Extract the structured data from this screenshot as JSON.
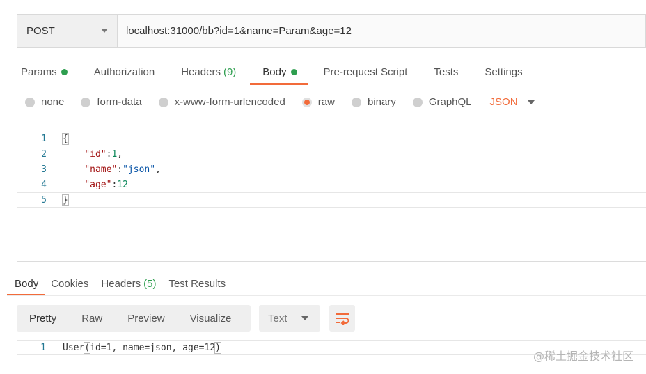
{
  "request": {
    "method": "POST",
    "url": "localhost:31000/bb?id=1&name=Param&age=12"
  },
  "request_tabs": [
    {
      "label": "Params",
      "dot": true
    },
    {
      "label": "Authorization"
    },
    {
      "label": "Headers",
      "count": "(9)"
    },
    {
      "label": "Body",
      "dot": true,
      "active": true
    },
    {
      "label": "Pre-request Script"
    },
    {
      "label": "Tests"
    },
    {
      "label": "Settings"
    }
  ],
  "body_types": {
    "options": [
      "none",
      "form-data",
      "x-www-form-urlencoded",
      "raw",
      "binary",
      "GraphQL"
    ],
    "selected": "raw",
    "language": "JSON"
  },
  "editor": {
    "line_numbers": [
      "1",
      "2",
      "3",
      "4",
      "5"
    ],
    "tokens": {
      "open_brace": "{",
      "close_brace": "}",
      "indent": "    ",
      "key_id": "\"id\"",
      "val_id": "1",
      "key_name": "\"name\"",
      "val_name": "\"json\"",
      "key_age": "\"age\"",
      "val_age": "12",
      "colon": ":",
      "comma": ","
    }
  },
  "response_tabs": [
    {
      "label": "Body",
      "active": true
    },
    {
      "label": "Cookies"
    },
    {
      "label": "Headers",
      "count": "(5)"
    },
    {
      "label": "Test Results"
    }
  ],
  "response_toolbar": {
    "views": [
      "Pretty",
      "Raw",
      "Preview",
      "Visualize"
    ],
    "active_view": "Pretty",
    "format": "Text"
  },
  "response_body": {
    "line_number": "1",
    "prefix": "User",
    "open_paren": "(",
    "content": "id=1, name=json, age=12",
    "close_paren": ")"
  },
  "watermark": "@稀土掘金技术社区",
  "colors": {
    "accent": "#f26b3a",
    "status_green": "#2e9e4f",
    "line_number": "#237893",
    "json_key": "#a31515",
    "json_number": "#098658",
    "json_string": "#0451a5"
  },
  "icons": {
    "method_dropdown": "chevron-down-icon",
    "format_dropdown": "chevron-down-icon",
    "wrap_lines": "wrap-lines-icon"
  }
}
